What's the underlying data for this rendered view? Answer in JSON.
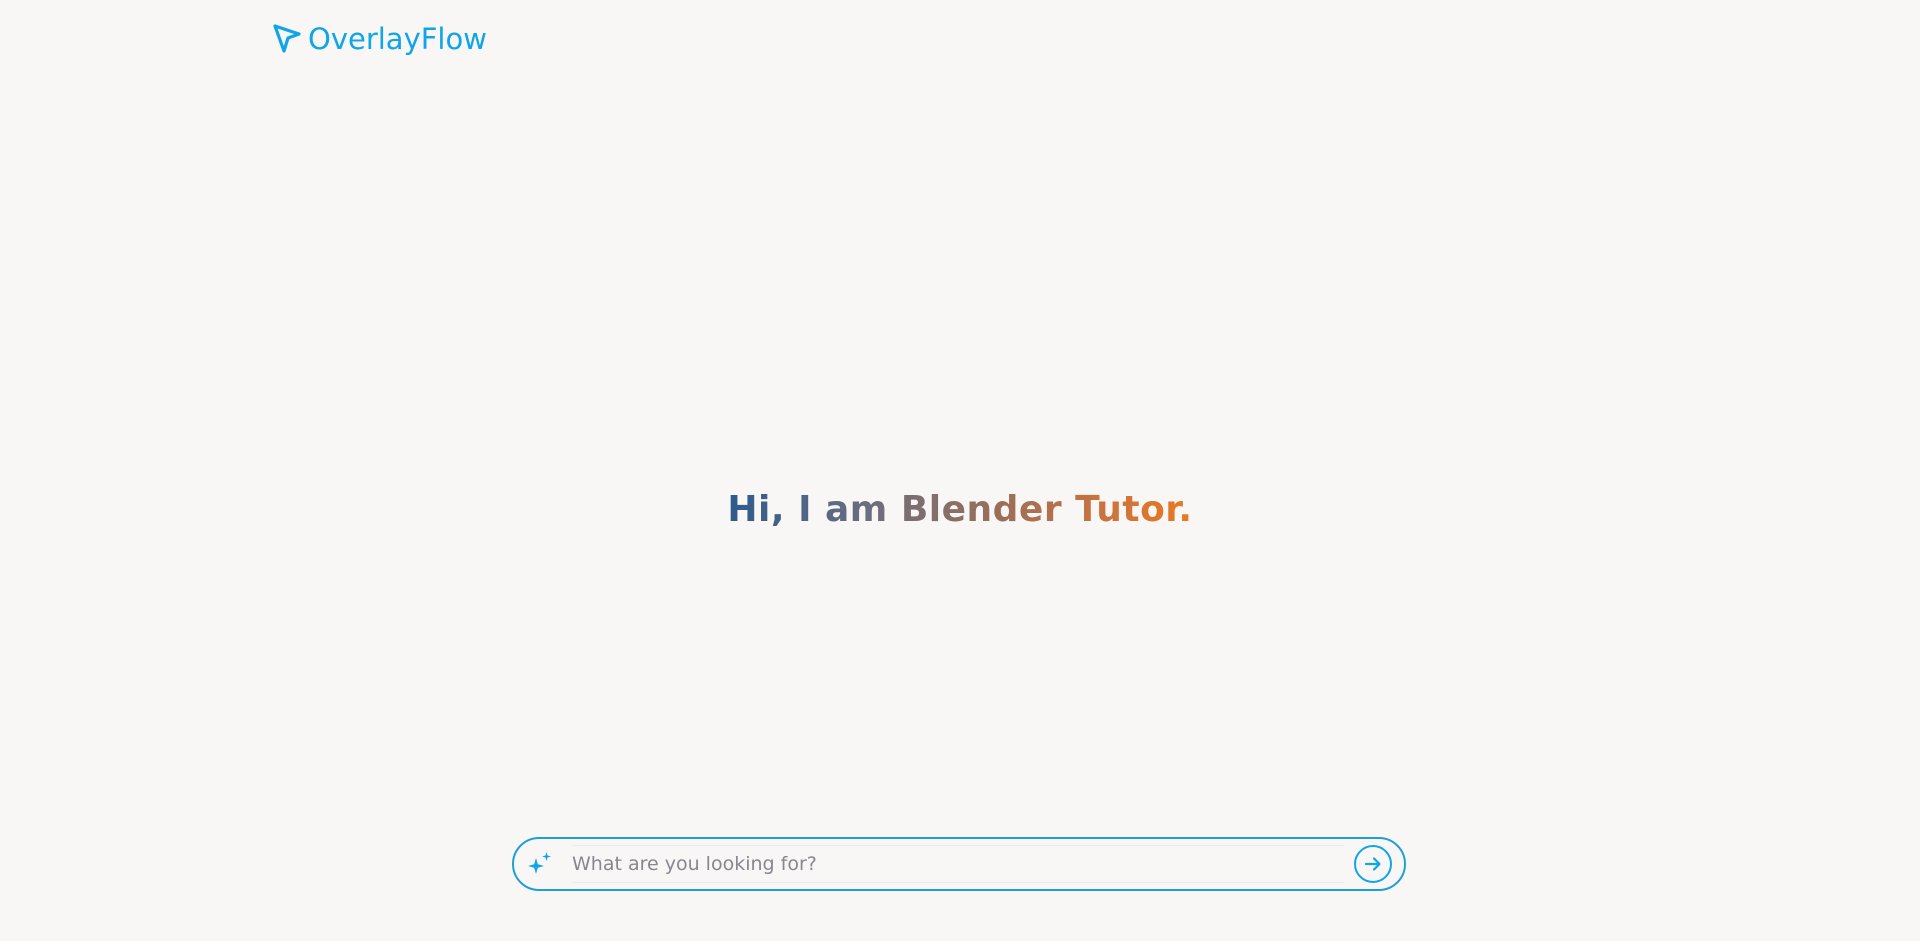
{
  "brand": {
    "name": "OverlayFlow",
    "icon": "cursor-arrow-icon",
    "color": "#0ea5e9"
  },
  "hero": {
    "text": "Hi, I am Blender Tutor.",
    "gradient": [
      "#2c5b8c",
      "#6b6e7e",
      "#9a6e5b",
      "#c97340",
      "#ea7a1f"
    ]
  },
  "search": {
    "placeholder": "What are you looking for?",
    "value": "",
    "leading_icon": "sparkles-icon",
    "submit_icon": "arrow-right-circle-icon",
    "accent": "#1ea0d7"
  }
}
